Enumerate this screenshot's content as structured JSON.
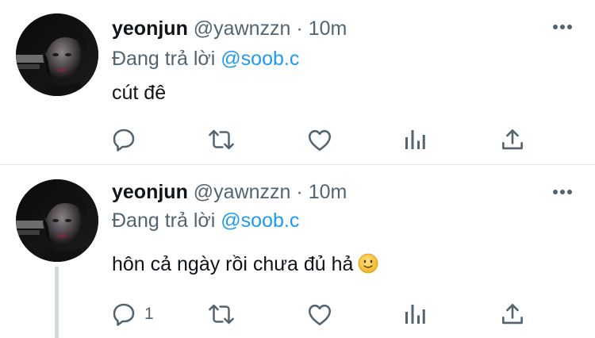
{
  "tweets": [
    {
      "name": "yeonjun",
      "handle": "@yawnzzn",
      "separator": "·",
      "time": "10m",
      "replying_prefix": "Đang trả lời",
      "replying_to": "@soob.c",
      "text": "cút đê",
      "reply_count": "",
      "icons": [
        "avatar-photo",
        "more-icon",
        "reply-icon",
        "retweet-icon",
        "like-icon",
        "analytics-icon",
        "share-icon"
      ]
    },
    {
      "name": "yeonjun",
      "handle": "@yawnzzn",
      "separator": "·",
      "time": "10m",
      "replying_prefix": "Đang trả lời",
      "replying_to": "@soob.c",
      "text": "hôn cả ngày rồi chưa đủ hả",
      "reply_count": "1",
      "emoji": "slightly-smiling-face",
      "icons": [
        "avatar-photo",
        "more-icon",
        "reply-icon",
        "retweet-icon",
        "like-icon",
        "analytics-icon",
        "share-icon"
      ]
    }
  ],
  "colors": {
    "text": "#0f1419",
    "secondary": "#536471",
    "link": "#1d9bf0",
    "divider": "#e6ecf0",
    "thread_line": "#cfd9de"
  }
}
